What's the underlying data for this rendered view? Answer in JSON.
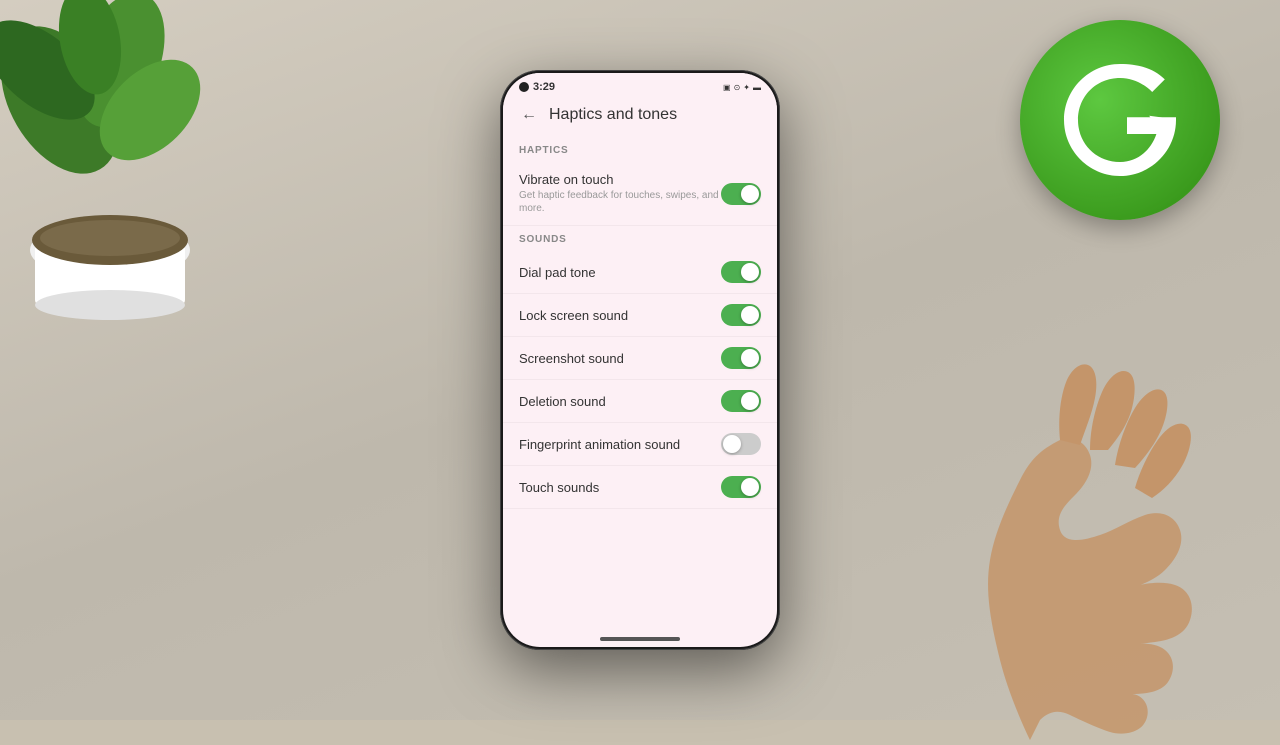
{
  "background": {
    "color": "#c8c0b0"
  },
  "status_bar": {
    "time": "3:29",
    "icons": "▣ ⊙ ✦ ))) ▪▪▪ 🔋"
  },
  "header": {
    "back_label": "←",
    "title": "Haptics and tones"
  },
  "sections": [
    {
      "id": "haptics",
      "label": "HAPTICS",
      "items": [
        {
          "id": "vibrate-on-touch",
          "title": "Vibrate on touch",
          "subtitle": "Get haptic feedback for touches, swipes, and more.",
          "toggle": "on"
        }
      ]
    },
    {
      "id": "sounds",
      "label": "SOUNDS",
      "items": [
        {
          "id": "dial-pad-tone",
          "title": "Dial pad tone",
          "subtitle": "",
          "toggle": "on"
        },
        {
          "id": "lock-screen-sound",
          "title": "Lock screen sound",
          "subtitle": "",
          "toggle": "on"
        },
        {
          "id": "screenshot-sound",
          "title": "Screenshot sound",
          "subtitle": "",
          "toggle": "on"
        },
        {
          "id": "deletion-sound",
          "title": "Deletion sound",
          "subtitle": "",
          "toggle": "on"
        },
        {
          "id": "fingerprint-animation-sound",
          "title": "Fingerprint animation sound",
          "subtitle": "",
          "toggle": "off"
        },
        {
          "id": "touch-sounds",
          "title": "Touch sounds",
          "subtitle": "",
          "toggle": "on"
        }
      ]
    }
  ],
  "home_indicator": true,
  "colors": {
    "toggle_on": "#4caf50",
    "toggle_off": "#c5c5c5",
    "screen_bg": "#fdf0f5",
    "text_primary": "#333333",
    "text_secondary": "#999999",
    "section_label": "#888888"
  },
  "logo": {
    "alt": "G logo",
    "color": "#4caf50"
  }
}
